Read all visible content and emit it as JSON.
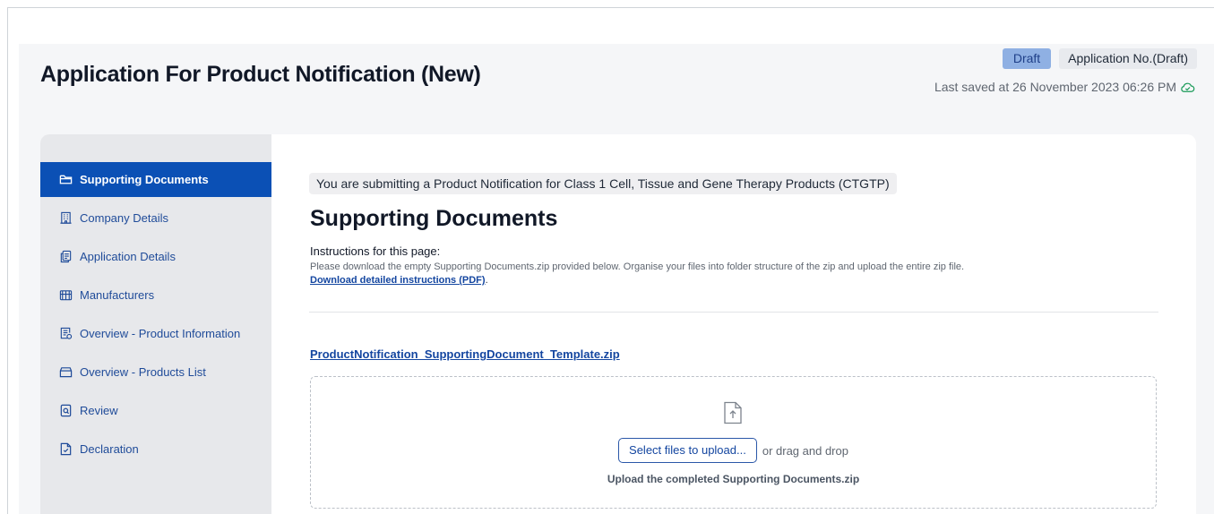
{
  "header": {
    "title": "Application For Product Notification (New)",
    "status_badge": "Draft",
    "application_no": "Application No.(Draft)",
    "last_saved": "Last saved at 26 November 2023 06:26 PM"
  },
  "sidebar": {
    "items": [
      {
        "label": "Supporting Documents",
        "icon": "folder-icon",
        "active": true
      },
      {
        "label": "Company Details",
        "icon": "building-icon",
        "active": false
      },
      {
        "label": "Application Details",
        "icon": "documents-icon",
        "active": false
      },
      {
        "label": "Manufacturers",
        "icon": "factory-icon",
        "active": false
      },
      {
        "label": "Overview - Product Information",
        "icon": "product-info-icon",
        "active": false
      },
      {
        "label": "Overview - Products List",
        "icon": "box-icon",
        "active": false
      },
      {
        "label": "Review",
        "icon": "document-search-icon",
        "active": false
      },
      {
        "label": "Declaration",
        "icon": "document-check-icon",
        "active": false
      }
    ]
  },
  "main": {
    "notice": "You are submitting a Product Notification for Class 1 Cell, Tissue and Gene Therapy Products (CTGTP)",
    "section_title": "Supporting Documents",
    "instructions_heading": "Instructions for this page:",
    "instructions_text": "Please download the empty Supporting Documents.zip provided below. Organise your files into folder structure of the zip and upload the entire zip file.",
    "instructions_link": "Download detailed instructions (PDF)",
    "instructions_link_suffix": ".",
    "template_link": "ProductNotification_SupportingDocument_Template.zip",
    "upload": {
      "button_label": "Select files to upload...",
      "drag_text": "or drag and drop",
      "caption": "Upload the completed Supporting Documents.zip"
    }
  },
  "colors": {
    "accent": "#0b50b5",
    "link": "#1446a0",
    "draft_badge": "#8fb0e3",
    "saved_icon": "#1a9a58"
  }
}
